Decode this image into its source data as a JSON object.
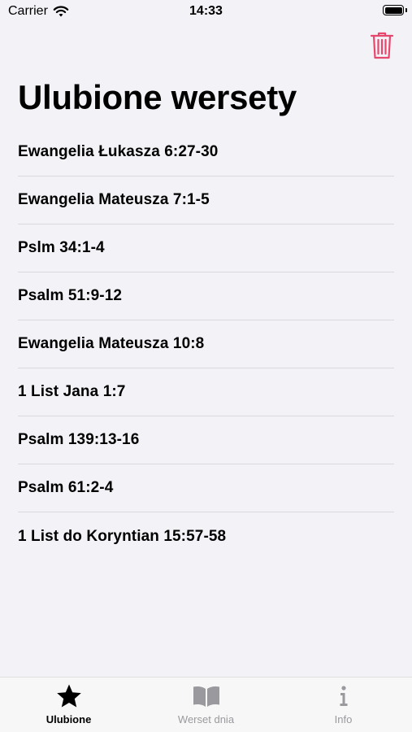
{
  "status_bar": {
    "carrier": "Carrier",
    "time": "14:33"
  },
  "toolbar": {
    "trash_icon": "trash-icon",
    "trash_color": "#e8476d"
  },
  "header": {
    "title": "Ulubione wersety"
  },
  "favorites": [
    "Ewangelia Łukasza 6:27-30",
    "Ewangelia Mateusza 7:1-5",
    "Pslm 34:1-4",
    "Psalm 51:9-12",
    "Ewangelia Mateusza 10:8",
    "1 List Jana 1:7",
    "Psalm 139:13-16",
    "Psalm 61:2-4",
    "1 List do Koryntian 15:57-58"
  ],
  "tab_bar": {
    "tabs": [
      {
        "label": "Ulubione",
        "icon": "star-icon",
        "active": true
      },
      {
        "label": "Werset dnia",
        "icon": "book-icon",
        "active": false
      },
      {
        "label": "Info",
        "icon": "info-icon",
        "active": false
      }
    ],
    "active_color": "#000000",
    "inactive_color": "#9a9a9e"
  }
}
